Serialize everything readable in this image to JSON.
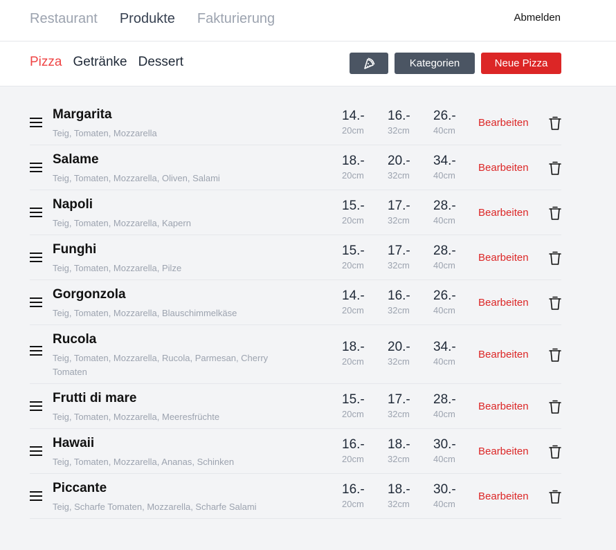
{
  "topnav": {
    "items": [
      {
        "label": "Restaurant",
        "active": false
      },
      {
        "label": "Produkte",
        "active": true
      },
      {
        "label": "Fakturierung",
        "active": false
      }
    ],
    "logout": "Abmelden"
  },
  "subnav": {
    "items": [
      {
        "label": "Pizza",
        "active": true
      },
      {
        "label": "Getränke",
        "active": false
      },
      {
        "label": "Dessert",
        "active": false
      }
    ]
  },
  "actions": {
    "icon_button_icon": "pizza-icon",
    "categories_label": "Kategorien",
    "new_label": "Neue Pizza"
  },
  "sizes": [
    "20cm",
    "32cm",
    "40cm"
  ],
  "edit_label": "Bearbeiten",
  "pizzas": [
    {
      "name": "Margarita",
      "ingredients": "Teig, Tomaten, Mozzarella",
      "prices": [
        "14.-",
        "16.-",
        "26.-"
      ]
    },
    {
      "name": "Salame",
      "ingredients": "Teig, Tomaten, Mozzarella, Oliven, Salami",
      "prices": [
        "18.-",
        "20.-",
        "34.-"
      ]
    },
    {
      "name": "Napoli",
      "ingredients": "Teig, Tomaten, Mozzarella, Kapern",
      "prices": [
        "15.-",
        "17.-",
        "28.-"
      ]
    },
    {
      "name": "Funghi",
      "ingredients": "Teig, Tomaten, Mozzarella, Pilze",
      "prices": [
        "15.-",
        "17.-",
        "28.-"
      ]
    },
    {
      "name": "Gorgonzola",
      "ingredients": "Teig, Tomaten, Mozzarella, Blauschimmelkäse",
      "prices": [
        "14.-",
        "16.-",
        "26.-"
      ]
    },
    {
      "name": "Rucola",
      "ingredients": "Teig, Tomaten, Mozzarella, Rucola, Parmesan, Cherry Tomaten",
      "prices": [
        "18.-",
        "20.-",
        "34.-"
      ]
    },
    {
      "name": "Frutti di mare",
      "ingredients": "Teig, Tomaten, Mozzarella, Meeresfrüchte",
      "prices": [
        "15.-",
        "17.-",
        "28.-"
      ]
    },
    {
      "name": "Hawaii",
      "ingredients": "Teig, Tomaten, Mozzarella, Ananas, Schinken",
      "prices": [
        "16.-",
        "18.-",
        "30.-"
      ]
    },
    {
      "name": "Piccante",
      "ingredients": "Teig, Scharfe Tomaten, Mozzarella, Scharfe Salami",
      "prices": [
        "16.-",
        "18.-",
        "30.-"
      ]
    }
  ],
  "colors": {
    "accent": "#dc2626",
    "button_dark": "#4b5563",
    "background": "#f3f4f6"
  }
}
